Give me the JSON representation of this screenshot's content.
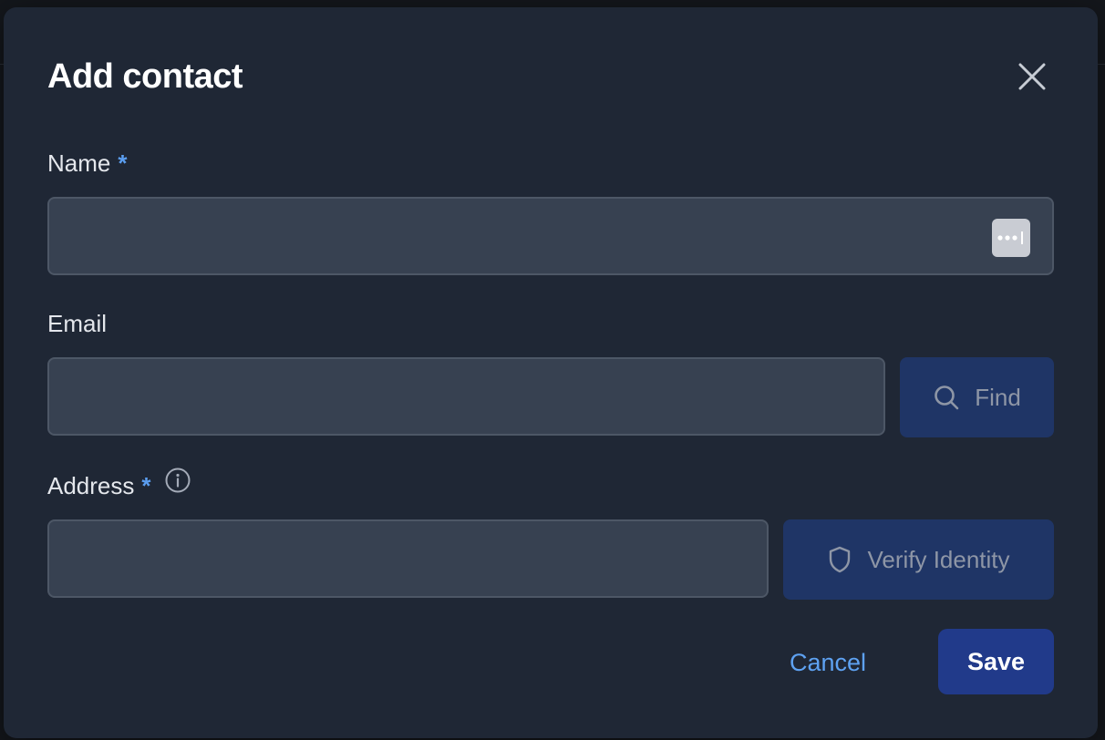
{
  "dialog": {
    "title": "Add contact",
    "close_icon": "close-icon"
  },
  "fields": {
    "name": {
      "label": "Name",
      "required_mark": "*",
      "value": "",
      "placeholder": "",
      "autofill_icon": "password-manager-icon"
    },
    "email": {
      "label": "Email",
      "value": "",
      "placeholder": "",
      "find_label": "Find",
      "find_icon": "search-icon"
    },
    "address": {
      "label": "Address",
      "required_mark": "*",
      "info_icon": "info-icon",
      "value": "",
      "placeholder": "",
      "verify_label": "Verify Identity",
      "verify_icon": "shield-icon"
    }
  },
  "actions": {
    "cancel_label": "Cancel",
    "save_label": "Save"
  },
  "colors": {
    "dialog_bg": "#1f2735",
    "input_bg": "#374151",
    "accent": "#5b9ef0",
    "primary_button": "#213a8a",
    "secondary_button": "#1f3566"
  }
}
